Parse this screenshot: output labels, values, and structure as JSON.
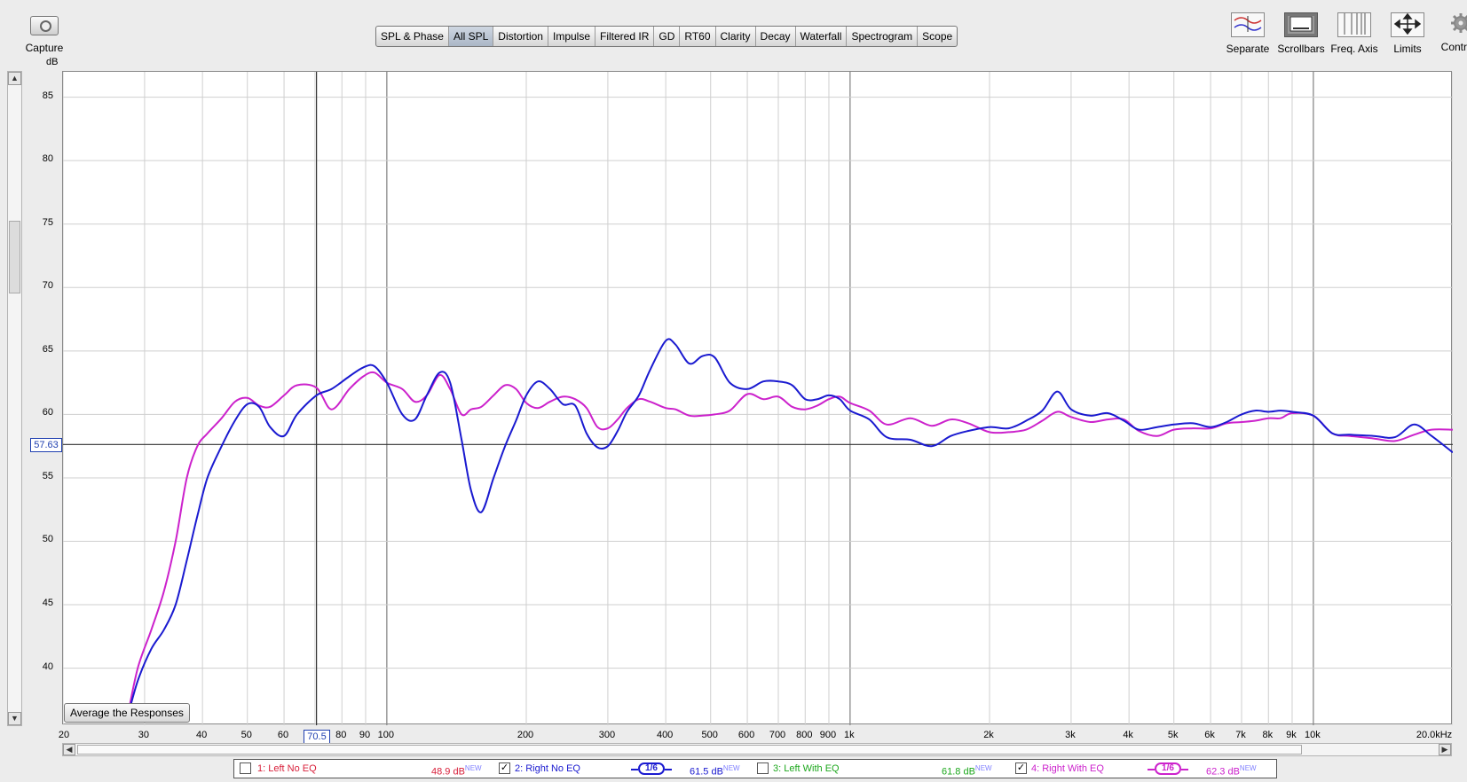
{
  "toolbar": {
    "capture_label": "Capture",
    "tabs": [
      {
        "label": "SPL & Phase",
        "active": false
      },
      {
        "label": "All SPL",
        "active": true
      },
      {
        "label": "Distortion",
        "active": false
      },
      {
        "label": "Impulse",
        "active": false
      },
      {
        "label": "Filtered IR",
        "active": false
      },
      {
        "label": "GD",
        "active": false
      },
      {
        "label": "RT60",
        "active": false
      },
      {
        "label": "Clarity",
        "active": false
      },
      {
        "label": "Decay",
        "active": false
      },
      {
        "label": "Waterfall",
        "active": false
      },
      {
        "label": "Spectrogram",
        "active": false
      },
      {
        "label": "Scope",
        "active": false
      }
    ],
    "right_tools": [
      {
        "label": "Separate",
        "icon": "separate-icon",
        "pressed": false
      },
      {
        "label": "Scrollbars",
        "icon": "scrollbars-icon",
        "pressed": true
      },
      {
        "label": "Freq. Axis",
        "icon": "freq-axis-icon",
        "pressed": false
      },
      {
        "label": "Limits",
        "icon": "limits-icon",
        "pressed": false
      },
      {
        "label": "Controls",
        "icon": "gear-icon",
        "pressed": false
      }
    ]
  },
  "plot": {
    "y_unit": "dB",
    "cursor_y_value": "57.63",
    "cursor_x_value": "70.5",
    "average_button_label": "Average the Responses"
  },
  "chart_data": {
    "type": "line",
    "x_scale": "log",
    "xlim": [
      20,
      20000
    ],
    "ylim": [
      35.5,
      87
    ],
    "y_ticks": [
      "85",
      "80",
      "75",
      "70",
      "65",
      "60",
      "55",
      "50",
      "45",
      "40"
    ],
    "y_tick_values": [
      85,
      80,
      75,
      70,
      65,
      60,
      55,
      50,
      45,
      40
    ],
    "x_ticks": [
      {
        "label": "20",
        "value": 20
      },
      {
        "label": "30",
        "value": 30
      },
      {
        "label": "40",
        "value": 40
      },
      {
        "label": "50",
        "value": 50
      },
      {
        "label": "60",
        "value": 60
      },
      {
        "label": "80",
        "value": 80
      },
      {
        "label": "90",
        "value": 90
      },
      {
        "label": "100",
        "value": 100
      },
      {
        "label": "200",
        "value": 200
      },
      {
        "label": "300",
        "value": 300
      },
      {
        "label": "400",
        "value": 400
      },
      {
        "label": "500",
        "value": 500
      },
      {
        "label": "600",
        "value": 600
      },
      {
        "label": "700",
        "value": 700
      },
      {
        "label": "800",
        "value": 800
      },
      {
        "label": "900",
        "value": 900
      },
      {
        "label": "1k",
        "value": 1000
      },
      {
        "label": "2k",
        "value": 2000
      },
      {
        "label": "3k",
        "value": 3000
      },
      {
        "label": "4k",
        "value": 4000
      },
      {
        "label": "5k",
        "value": 5000
      },
      {
        "label": "6k",
        "value": 6000
      },
      {
        "label": "7k",
        "value": 7000
      },
      {
        "label": "8k",
        "value": 8000
      },
      {
        "label": "9k",
        "value": 9000
      },
      {
        "label": "10k",
        "value": 10000
      },
      {
        "label": "20.0kHz",
        "value": 20000
      }
    ],
    "cursor": {
      "x": 70.5,
      "y": 57.63
    },
    "series": [
      {
        "name": "2: Right No EQ",
        "color": "#1a1ad0",
        "x": [
          27.5,
          29,
          31,
          33,
          35,
          37,
          39,
          41,
          44,
          47,
          50,
          53,
          56,
          60,
          64,
          70.5,
          76,
          83,
          89,
          94,
          100,
          108,
          115,
          122,
          130,
          137,
          145,
          152,
          160,
          170,
          180,
          190,
          200,
          212,
          225,
          240,
          255,
          270,
          285,
          300,
          315,
          330,
          350,
          370,
          400,
          420,
          450,
          480,
          510,
          550,
          600,
          650,
          700,
          750,
          800,
          850,
          900,
          950,
          1000,
          1100,
          1200,
          1350,
          1500,
          1650,
          1800,
          2000,
          2200,
          2400,
          2600,
          2800,
          3000,
          3300,
          3600,
          3900,
          4200,
          4600,
          5000,
          5500,
          6000,
          6500,
          7000,
          7500,
          8000,
          8500,
          9000,
          10000,
          11000,
          12000,
          13500,
          15000,
          16500,
          18000,
          20000
        ],
        "y": [
          36,
          39,
          41.5,
          43,
          45,
          48.5,
          52,
          55,
          57.5,
          59.5,
          60.8,
          60.6,
          59,
          58.3,
          60,
          61.5,
          62,
          63,
          63.7,
          63.8,
          62.5,
          60,
          59.6,
          61.5,
          63.3,
          62.5,
          58,
          54,
          52.3,
          55,
          57.5,
          59.5,
          61.5,
          62.6,
          62,
          60.8,
          60.7,
          58.5,
          57.4,
          57.5,
          58.7,
          60.2,
          61.5,
          63.5,
          65.8,
          65.5,
          64,
          64.6,
          64.5,
          62.5,
          62,
          62.6,
          62.6,
          62.3,
          61.2,
          61.2,
          61.5,
          61.2,
          60.3,
          59.6,
          58.2,
          58,
          57.5,
          58.3,
          58.7,
          59,
          58.9,
          59.5,
          60.3,
          61.8,
          60.4,
          59.9,
          60.1,
          59.5,
          58.8,
          59,
          59.2,
          59.3,
          59,
          59.4,
          60,
          60.3,
          60.2,
          60.3,
          60.2,
          59.9,
          58.5,
          58.4,
          58.3,
          58.2,
          59.2,
          58.3,
          57
        ]
      },
      {
        "name": "4: Right With EQ",
        "color": "#cc22cc",
        "x": [
          27.5,
          29,
          31,
          33,
          35,
          37,
          39,
          41,
          44,
          47,
          50,
          53,
          56,
          60,
          64,
          70.5,
          76,
          83,
          89,
          94,
          100,
          108,
          115,
          122,
          130,
          137,
          145,
          152,
          160,
          170,
          180,
          190,
          200,
          212,
          225,
          240,
          255,
          270,
          285,
          300,
          315,
          330,
          350,
          370,
          400,
          420,
          450,
          480,
          510,
          550,
          600,
          650,
          700,
          750,
          800,
          850,
          900,
          950,
          1000,
          1100,
          1200,
          1350,
          1500,
          1650,
          1800,
          2000,
          2200,
          2400,
          2600,
          2800,
          3000,
          3300,
          3600,
          3900,
          4200,
          4600,
          5000,
          5500,
          6000,
          6500,
          7000,
          7500,
          8000,
          8500,
          9000,
          10000,
          11000,
          12000,
          13500,
          15000,
          16500,
          18000,
          20000
        ],
        "y": [
          36,
          40,
          43,
          46,
          50,
          55,
          57.5,
          58.5,
          59.7,
          61,
          61.3,
          60.7,
          60.6,
          61.5,
          62.3,
          62.1,
          60.4,
          62,
          63,
          63.3,
          62.5,
          62,
          61,
          61.5,
          63.1,
          62,
          60,
          60.4,
          60.6,
          61.5,
          62.3,
          62,
          60.9,
          60.5,
          61,
          61.4,
          61.2,
          60.5,
          59,
          58.9,
          59.6,
          60.5,
          61.2,
          61,
          60.5,
          60.4,
          59.9,
          59.9,
          60,
          60.3,
          61.6,
          61.2,
          61.4,
          60.6,
          60.4,
          60.7,
          61.2,
          61.4,
          60.9,
          60.3,
          59.2,
          59.7,
          59.1,
          59.6,
          59.3,
          58.6,
          58.6,
          58.8,
          59.5,
          60.2,
          59.8,
          59.4,
          59.6,
          59.6,
          58.7,
          58.3,
          58.8,
          58.9,
          58.9,
          59.3,
          59.4,
          59.5,
          59.7,
          59.7,
          60.1,
          59.9,
          58.5,
          58.3,
          58.1,
          57.9,
          58.4,
          58.8,
          58.8
        ]
      }
    ]
  },
  "legend": [
    {
      "label": "1: Left No EQ",
      "checked": false,
      "value": "48.9 dB",
      "badge": "NEW",
      "color": "#d81f3a",
      "smoothing": ""
    },
    {
      "label": "2: Right No EQ",
      "checked": true,
      "value": "61.5 dB",
      "badge": "NEW",
      "color": "#1a1ad0",
      "smoothing": "1/6"
    },
    {
      "label": "3: Left With EQ",
      "checked": false,
      "value": "61.8 dB",
      "badge": "NEW",
      "color": "#1da81d",
      "smoothing": ""
    },
    {
      "label": "4: Right With EQ",
      "checked": true,
      "value": "62.3 dB",
      "badge": "NEW",
      "color": "#cc22cc",
      "smoothing": "1/6"
    }
  ]
}
